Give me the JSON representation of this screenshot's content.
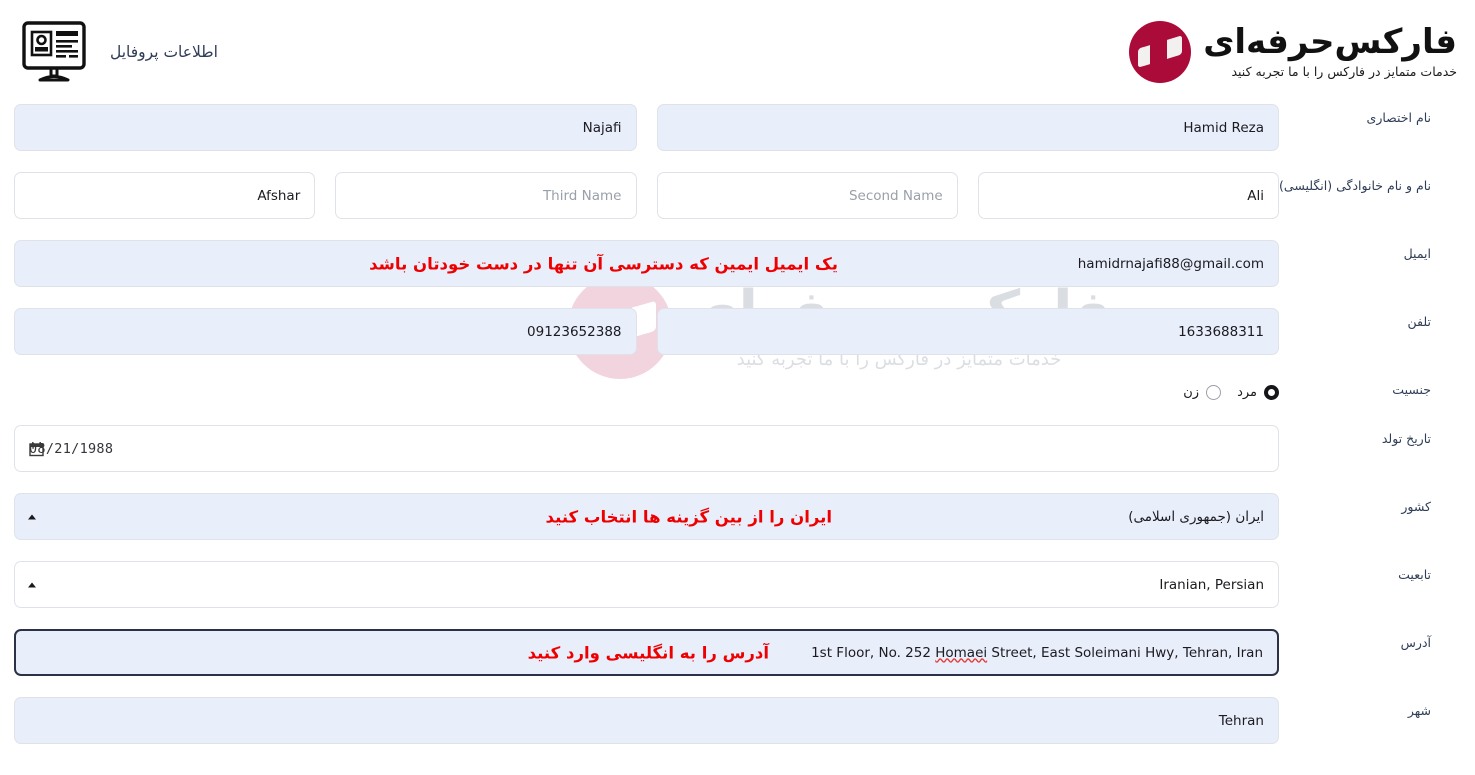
{
  "brand": {
    "title": "فارکس‌حرفه‌ای",
    "subtitle": "خدمات متمایز در فارکس را با ما تجربه کنید",
    "logo_color": "#ab0b38"
  },
  "header": {
    "page_title": "اطلاعات پروفایل",
    "icon": "profile-monitor-icon"
  },
  "watermark": {
    "title": "فارکس‌حرفه‌ای",
    "subtitle": "خدمات متمایز در فارکس را با ما تجربه کنید"
  },
  "notes_color": "#ee0000",
  "form": {
    "nickname": {
      "label": "نام اختصاری",
      "last": "Najafi",
      "first": "Hamid Reza"
    },
    "fullname_en": {
      "label": "نام و نام خانوادگی (انگلیسی)",
      "fourth_value": "Afshar",
      "third_placeholder": "Third Name",
      "second_placeholder": "Second Name",
      "first_value": "Ali"
    },
    "email": {
      "label": "ایمیل",
      "value": "hamidrnajafi88@gmail.com",
      "note": "یک ایمیل ایمین که دسترسی آن تنها در دست خودتان باشد"
    },
    "phone": {
      "label": "تلفن",
      "mobile": "09123652388",
      "landline": "1633688311"
    },
    "gender": {
      "label": "جنسیت",
      "male": "مرد",
      "female": "زن",
      "selected": "مرد"
    },
    "birthdate": {
      "label": "تاریخ تولد",
      "value": "08/21/1988",
      "icon": "calendar-icon"
    },
    "country": {
      "label": "کشور",
      "value": "ایران (جمهوری اسلامی)",
      "note": "ایران را از بین گزینه ها انتخاب کنید",
      "indicator": "caret-up-icon"
    },
    "nationality": {
      "label": "تابعیت",
      "value": "Iranian, Persian",
      "indicator": "caret-up-icon"
    },
    "address": {
      "label": "آدرس",
      "value_before": "1st Floor, No. 252 ",
      "value_misspelled": "Homaei",
      "value_after": " Street, East Soleimani Hwy, Tehran, Iran",
      "note": "آدرس را به انگلیسی وارد کنید"
    },
    "city": {
      "label": "شهر",
      "value": "Tehran"
    }
  }
}
